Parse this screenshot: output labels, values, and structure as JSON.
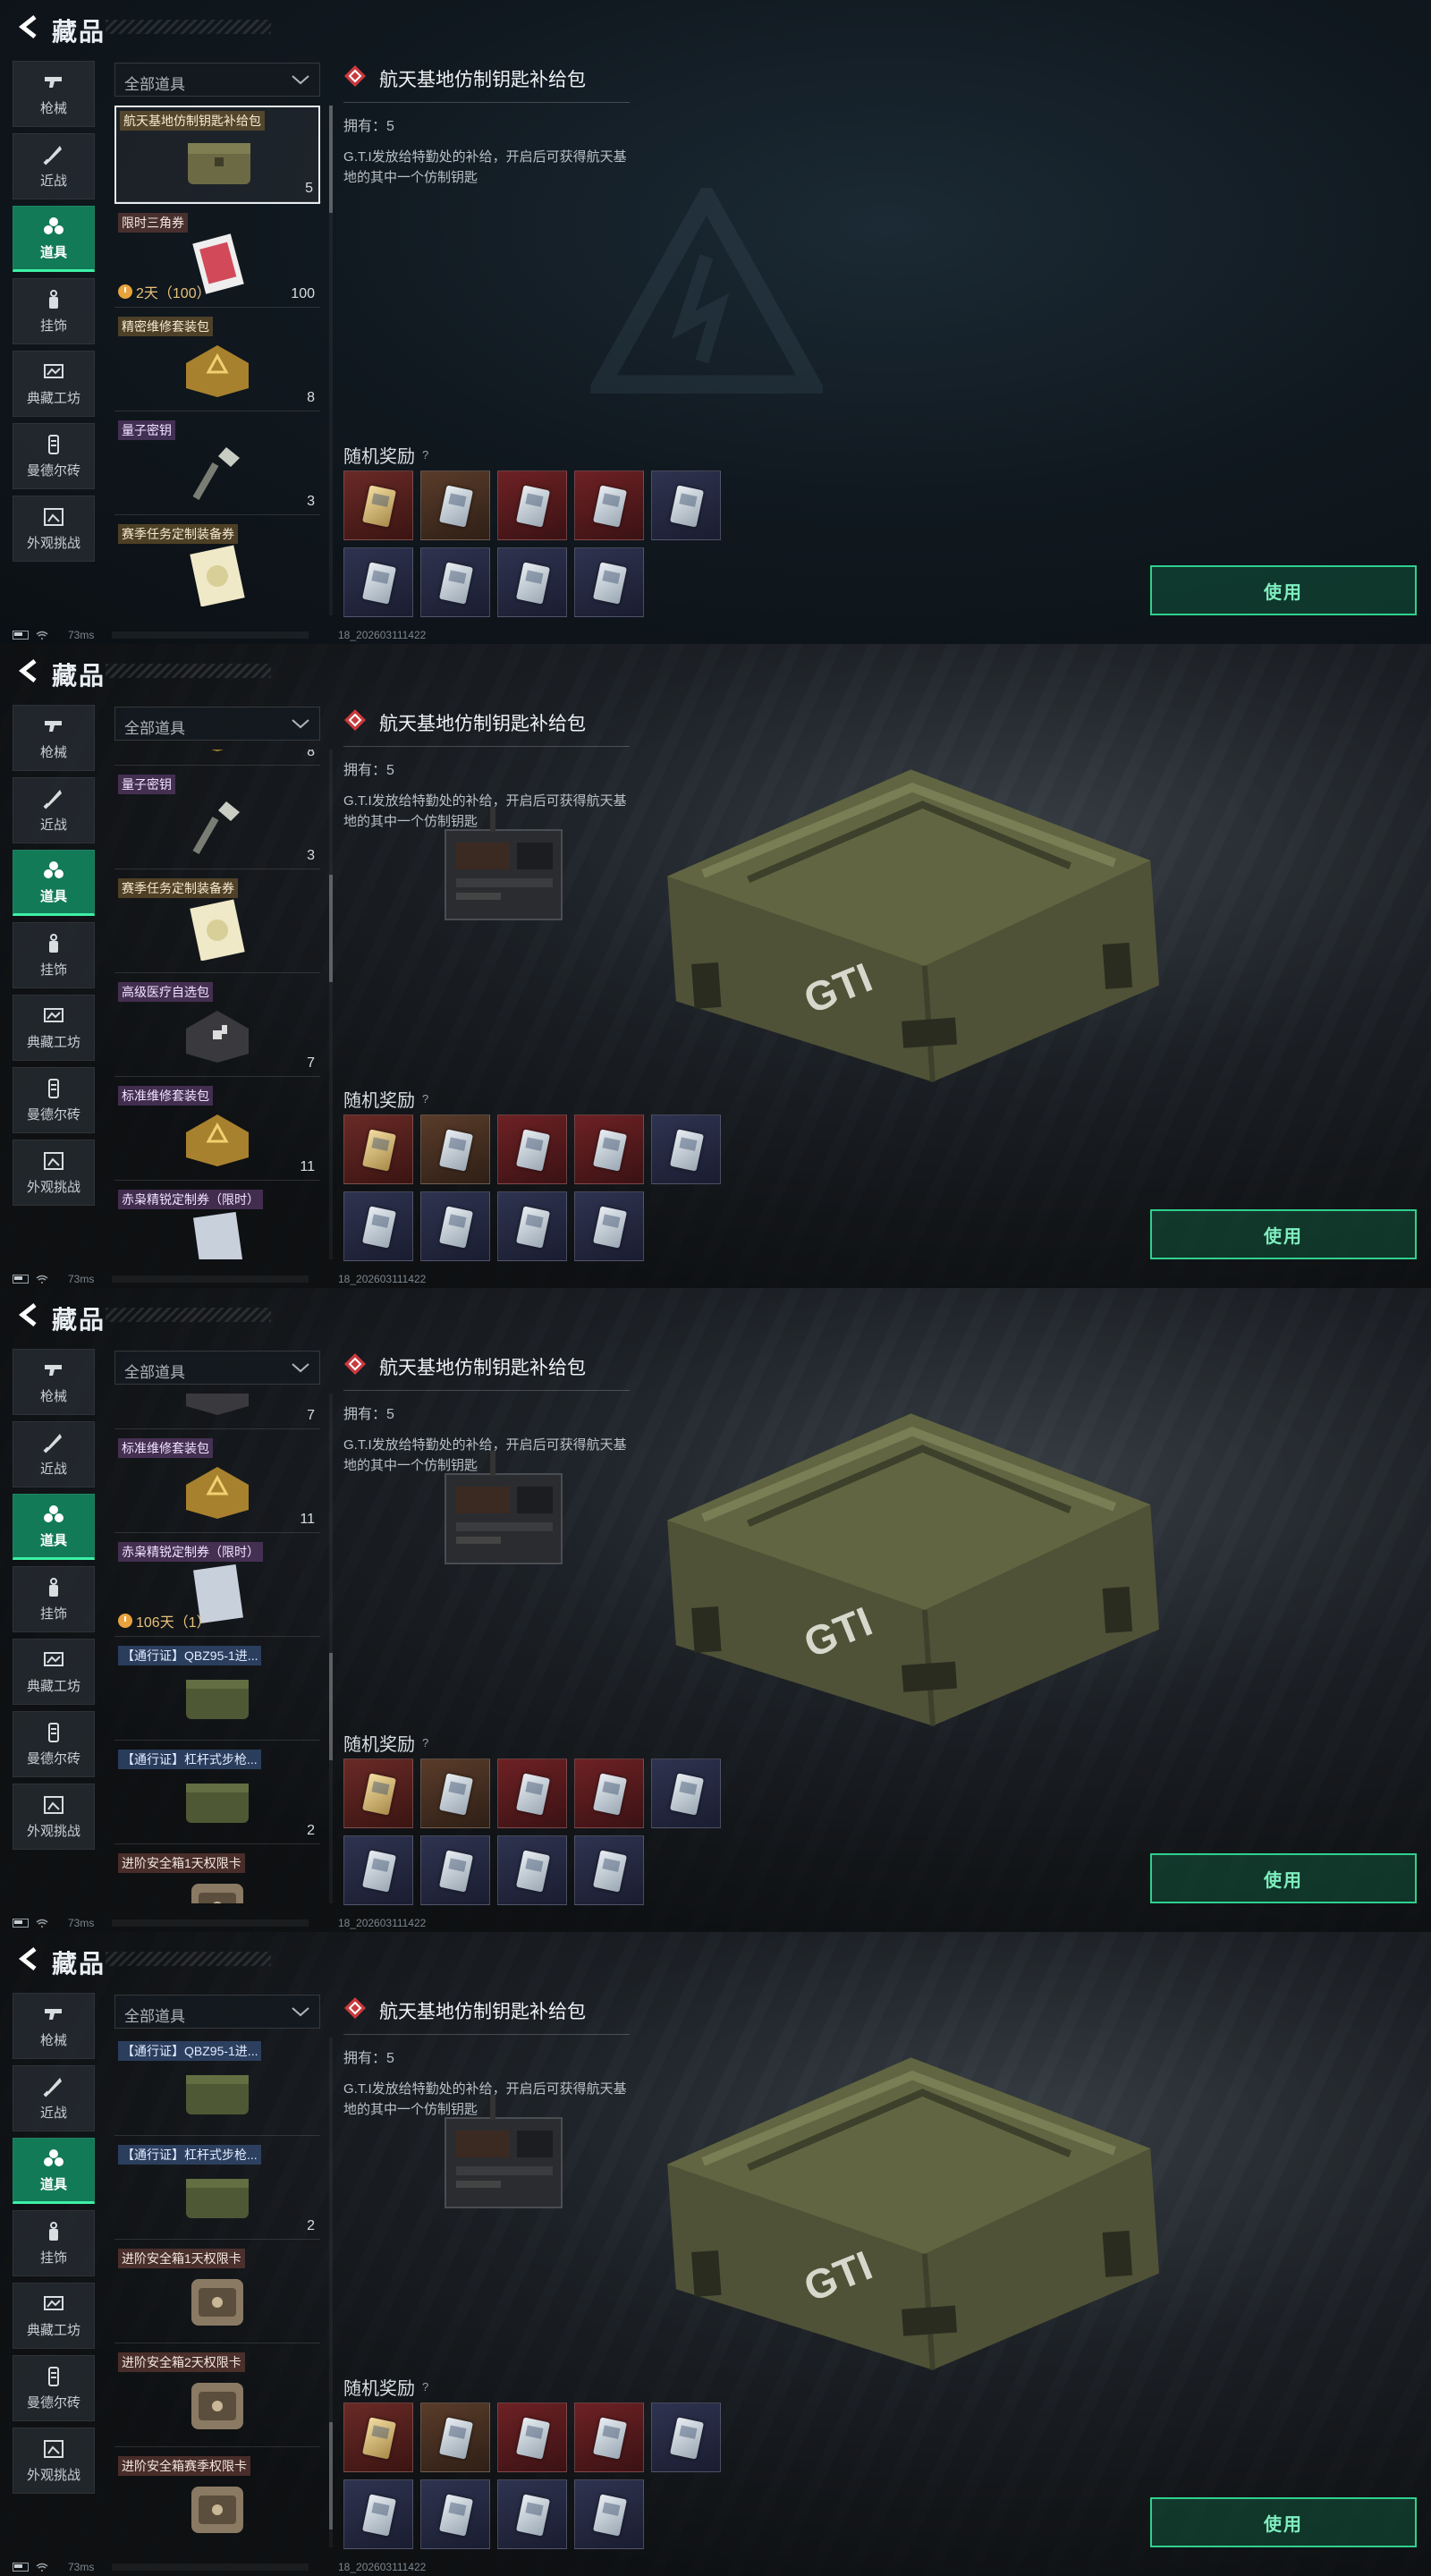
{
  "header": {
    "title": "藏品"
  },
  "sidebar": {
    "items": [
      {
        "label": "枪械",
        "icon": "gun-icon"
      },
      {
        "label": "近战",
        "icon": "knife-icon"
      },
      {
        "label": "道具",
        "icon": "items-icon",
        "active": true
      },
      {
        "label": "挂饰",
        "icon": "charm-icon"
      },
      {
        "label": "典藏工坊",
        "icon": "workshop-icon"
      },
      {
        "label": "曼德尔砖",
        "icon": "brick-icon"
      },
      {
        "label": "外观挑战",
        "icon": "challenge-icon"
      }
    ]
  },
  "filter": {
    "label": "全部道具"
  },
  "items": {
    "i0": {
      "name": "航天基地仿制钥匙补给包",
      "count": "5"
    },
    "i1": {
      "name": "限时三角券",
      "timer": "2天（100）",
      "count": "100"
    },
    "i2": {
      "name": "精密维修套装包",
      "count": "8"
    },
    "i3": {
      "name": "量子密钥",
      "count": "3"
    },
    "i4": {
      "name": "赛季任务定制装备券"
    },
    "i5": {
      "name": "高级医疗自选包",
      "count": "7"
    },
    "i6": {
      "name": "标准维修套装包",
      "count": "11"
    },
    "i7": {
      "name": "赤枭精锐定制券（限时）",
      "timer": "106天（1）"
    },
    "i8": {
      "name": "【通行证】QBZ95-1进..."
    },
    "i9": {
      "name": "【通行证】杠杆式步枪...",
      "count": "2"
    },
    "i10": {
      "name": "进阶安全箱1天权限卡"
    },
    "i11": {
      "name": "进阶安全箱2天权限卡"
    },
    "i12": {
      "name": "进阶安全箱赛季权限卡"
    }
  },
  "detail": {
    "name": "航天基地仿制钥匙补给包",
    "owned": "拥有：5",
    "description": "G.T.I发放给特勤处的补给，开启后可获得航天基地的其中一个仿制钥匙",
    "rewards_title": "随机奖励",
    "rewards_help": "?",
    "rewards": [
      "gold",
      "brown",
      "red",
      "red",
      "blue",
      "blue",
      "blue",
      "blue",
      "blue"
    ],
    "crate_text": "GTI",
    "use_button": "使用"
  },
  "status": {
    "latency": "73ms",
    "build": "18_202603111422"
  },
  "colors": {
    "accent": "#2fd18e",
    "active_tab": "#127a57"
  }
}
